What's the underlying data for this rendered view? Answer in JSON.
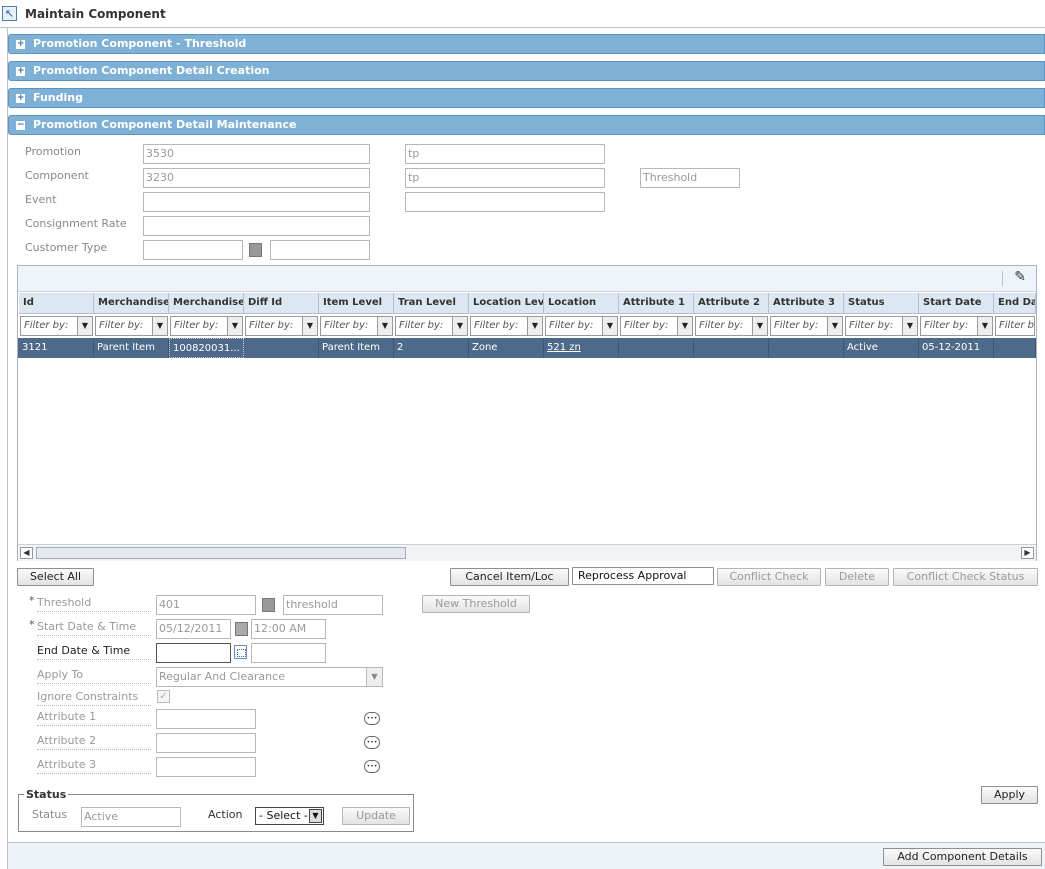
{
  "page": {
    "title": "Maintain Component"
  },
  "sections": {
    "threshold": "Promotion Component - Threshold",
    "detail_creation": "Promotion Component Detail Creation",
    "funding": "Funding",
    "detail_maintenance": "Promotion Component Detail Maintenance"
  },
  "header_form": {
    "promotion_label": "Promotion",
    "promotion_value": "3530",
    "promotion_desc": "tp",
    "component_label": "Component",
    "component_value": "3230",
    "component_desc": "tp",
    "component_type": "Threshold",
    "event_label": "Event",
    "event_value": "",
    "event_desc": "",
    "consignment_label": "Consignment Rate",
    "consignment_value": "",
    "customer_type_label": "Customer Type",
    "customer_type_value": "",
    "customer_type_desc": ""
  },
  "grid": {
    "columns": [
      "Id",
      "Merchandise L",
      "Merchandise I",
      "Diff Id",
      "Item Level",
      "Tran Level",
      "Location Leve",
      "Location",
      "Attribute 1",
      "Attribute 2",
      "Attribute 3",
      "Status",
      "Start Date",
      "End Dat"
    ],
    "filter_placeholder": "Filter by:",
    "last_filter": "Filter b",
    "rows": [
      [
        "3121",
        "Parent Item",
        "100820031...",
        "",
        "Parent Item",
        "2",
        "Zone",
        "521 zn",
        "",
        "",
        "",
        "Active",
        "05-12-2011",
        ""
      ]
    ]
  },
  "buttons": {
    "select_all": "Select All",
    "cancel_item_loc": "Cancel Item/Loc",
    "reprocess_approval": "Reprocess Approval",
    "conflict_check": "Conflict Check",
    "delete": "Delete",
    "conflict_check_status": "Conflict Check Status",
    "new_threshold": "New Threshold",
    "apply": "Apply",
    "update": "Update",
    "add_component_details": "Add Component Details"
  },
  "detail_form": {
    "threshold_label": "Threshold",
    "threshold_value": "401",
    "threshold_desc": "threshold",
    "start_label": "Start Date & Time",
    "start_date": "05/12/2011",
    "start_time": "12:00 AM",
    "end_label": "End Date & Time",
    "end_date": "",
    "end_time": "",
    "apply_to_label": "Apply To",
    "apply_to_value": "Regular And Clearance",
    "ignore_label": "Ignore Constraints",
    "attr1_label": "Attribute 1",
    "attr2_label": "Attribute 2",
    "attr3_label": "Attribute 3"
  },
  "status_box": {
    "legend": "Status",
    "status_label": "Status",
    "status_value": "Active",
    "action_label": "Action",
    "action_value": "- Select -"
  }
}
